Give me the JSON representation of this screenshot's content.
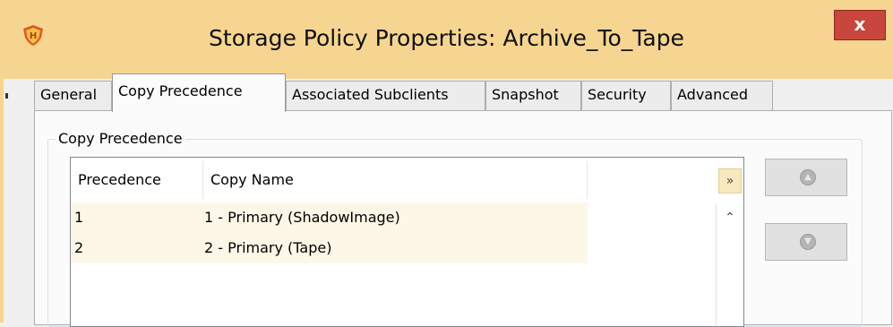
{
  "window": {
    "title": "Storage Policy Properties: Archive_To_Tape",
    "close_label": "x",
    "app_icon": "commvault-shield-icon"
  },
  "tabs": [
    {
      "label": "General",
      "active": false
    },
    {
      "label": "Copy Precedence",
      "active": true
    },
    {
      "label": "Associated Subclients",
      "active": false
    },
    {
      "label": "Snapshot",
      "active": false
    },
    {
      "label": "Security",
      "active": false
    },
    {
      "label": "Advanced",
      "active": false
    }
  ],
  "group": {
    "legend": "Copy Precedence"
  },
  "table": {
    "columns": [
      "Precedence",
      "Copy Name"
    ],
    "rows": [
      {
        "precedence": "1",
        "copy_name": "1 - Primary (ShadowImage)"
      },
      {
        "precedence": "2",
        "copy_name": "2 - Primary (Tape)"
      }
    ],
    "column_chooser_icon": "double-chevron-down-icon",
    "scroll_up_icon": "chevron-up-icon"
  },
  "side_buttons": [
    {
      "name": "move-up-button",
      "icon": "up-arrow-disc-icon",
      "enabled": false
    },
    {
      "name": "move-down-button",
      "icon": "down-arrow-disc-icon",
      "enabled": false
    }
  ]
}
